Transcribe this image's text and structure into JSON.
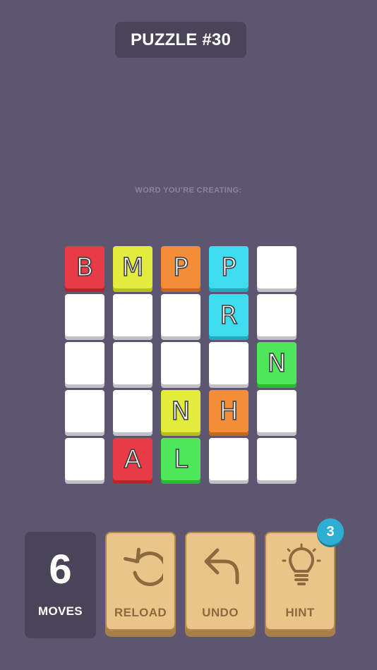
{
  "header": {
    "title": "PUZZLE #30"
  },
  "word_label": "WORD YOU'RE CREATING:",
  "board": {
    "rows": [
      [
        {
          "letter": "B",
          "color": "red"
        },
        {
          "letter": "M",
          "color": "yellow"
        },
        {
          "letter": "P",
          "color": "orange"
        },
        {
          "letter": "P",
          "color": "cyan"
        },
        {
          "letter": "",
          "color": "empty"
        }
      ],
      [
        {
          "letter": "",
          "color": "empty"
        },
        {
          "letter": "",
          "color": "empty"
        },
        {
          "letter": "",
          "color": "empty"
        },
        {
          "letter": "R",
          "color": "cyan"
        },
        {
          "letter": "",
          "color": "empty"
        }
      ],
      [
        {
          "letter": "",
          "color": "empty"
        },
        {
          "letter": "",
          "color": "empty"
        },
        {
          "letter": "",
          "color": "empty"
        },
        {
          "letter": "",
          "color": "empty"
        },
        {
          "letter": "N",
          "color": "green"
        }
      ],
      [
        {
          "letter": "",
          "color": "empty"
        },
        {
          "letter": "",
          "color": "empty"
        },
        {
          "letter": "N",
          "color": "yellow"
        },
        {
          "letter": "H",
          "color": "orange"
        },
        {
          "letter": "",
          "color": "empty"
        }
      ],
      [
        {
          "letter": "",
          "color": "empty"
        },
        {
          "letter": "A",
          "color": "red"
        },
        {
          "letter": "L",
          "color": "green"
        },
        {
          "letter": "",
          "color": "empty"
        },
        {
          "letter": "",
          "color": "empty"
        }
      ]
    ]
  },
  "moves": {
    "count": "6",
    "label": "MOVES"
  },
  "controls": {
    "reload_label": "RELOAD",
    "reload_icon": "reload-icon",
    "undo_label": "UNDO",
    "undo_icon": "undo-arrow-icon",
    "hint_label": "HINT",
    "hint_icon": "lightbulb-icon",
    "hint_badge": "3"
  },
  "colors": {
    "background": "#5e5670",
    "panel": "#4b4459",
    "button": "#ebc489",
    "button_text": "#8b6a3e",
    "badge": "#2eaed3",
    "tile_red": "#e93a47",
    "tile_yellow": "#e3ec3c",
    "tile_orange": "#f38d38",
    "tile_cyan": "#3fdcef",
    "tile_green": "#4ee65b"
  }
}
